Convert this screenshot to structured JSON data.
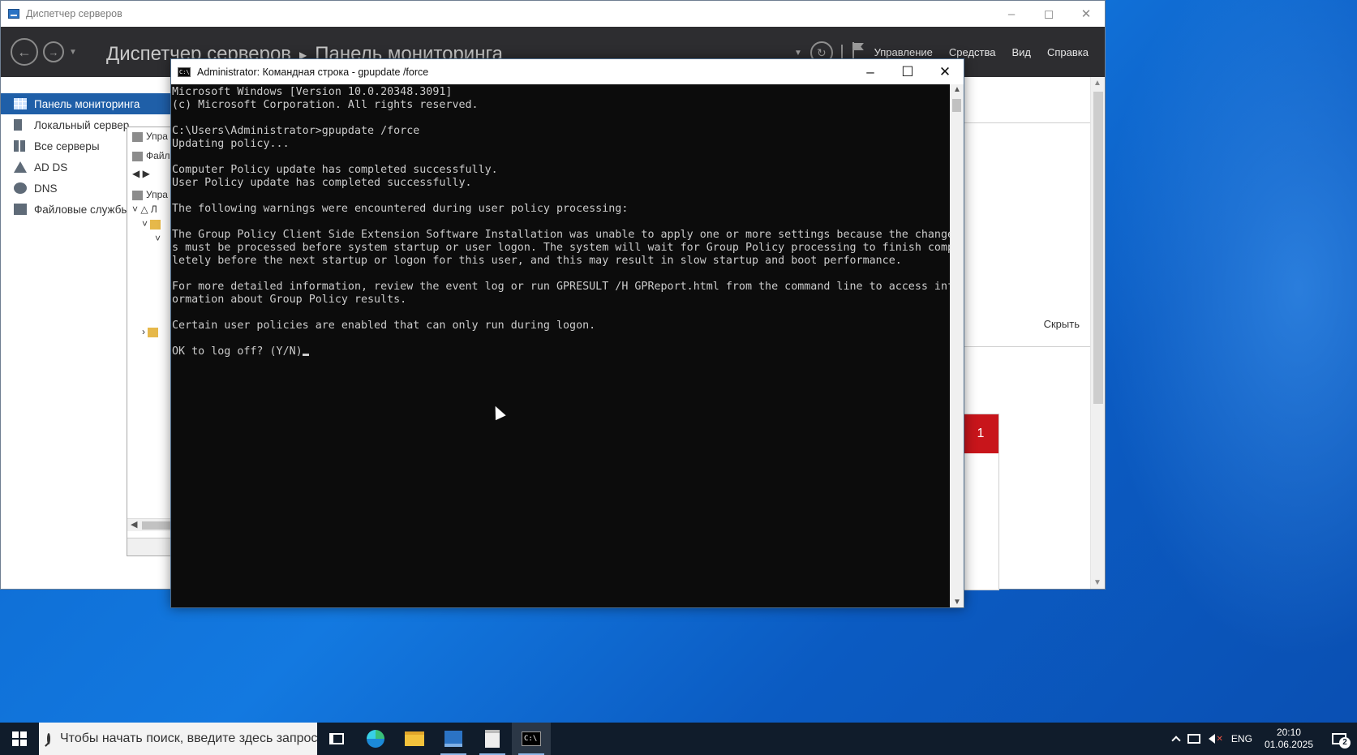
{
  "server_manager": {
    "title": "Диспетчер серверов",
    "breadcrumb_root": "Диспетчер серверов",
    "breadcrumb_page": "Панель мониторинга",
    "menu": [
      "Управление",
      "Средства",
      "Вид",
      "Справка"
    ],
    "sidebar": [
      {
        "label": "Панель мониторинга",
        "icon": "dashboard-icon",
        "active": true
      },
      {
        "label": "Локальный сервер",
        "icon": "server-icon"
      },
      {
        "label": "Все серверы",
        "icon": "servers-icon"
      },
      {
        "label": "AD DS",
        "icon": "ad-ds-icon"
      },
      {
        "label": "DNS",
        "icon": "dns-icon"
      },
      {
        "label": "Файловые службы",
        "icon": "file-services-icon"
      }
    ],
    "hide_label": "Скрыть",
    "tile_count": "1",
    "accent_color": "#1f5fa8",
    "alert_color": "#c8151b"
  },
  "mmc": {
    "rows": [
      "Упра",
      "Файл",
      "Упра",
      "Л"
    ]
  },
  "cmd": {
    "title": "Administrator: Командная строка - gpupdate  /force",
    "lines": [
      "Microsoft Windows [Version 10.0.20348.3091]",
      "(c) Microsoft Corporation. All rights reserved.",
      "",
      "C:\\Users\\Administrator>gpupdate /force",
      "Updating policy...",
      "",
      "Computer Policy update has completed successfully.",
      "User Policy update has completed successfully.",
      "",
      "The following warnings were encountered during user policy processing:",
      "",
      "The Group Policy Client Side Extension Software Installation was unable to apply one or more settings because the change",
      "s must be processed before system startup or user logon. The system will wait for Group Policy processing to finish comp",
      "letely before the next startup or logon for this user, and this may result in slow startup and boot performance.",
      "",
      "For more detailed information, review the event log or run GPRESULT /H GPReport.html from the command line to access inf",
      "ormation about Group Policy results.",
      "",
      "Certain user policies are enabled that can only run during logon.",
      ""
    ],
    "prompt": "OK to log off? (Y/N)"
  },
  "taskbar": {
    "search_placeholder": "Чтобы начать поиск, введите здесь запрос",
    "apps": [
      "task-view-icon",
      "edge-icon",
      "file-explorer-icon",
      "server-manager-icon",
      "notepad-icon",
      "cmd-icon"
    ],
    "language": "ENG",
    "time": "20:10",
    "date": "01.06.2025",
    "notification_count": "2"
  }
}
